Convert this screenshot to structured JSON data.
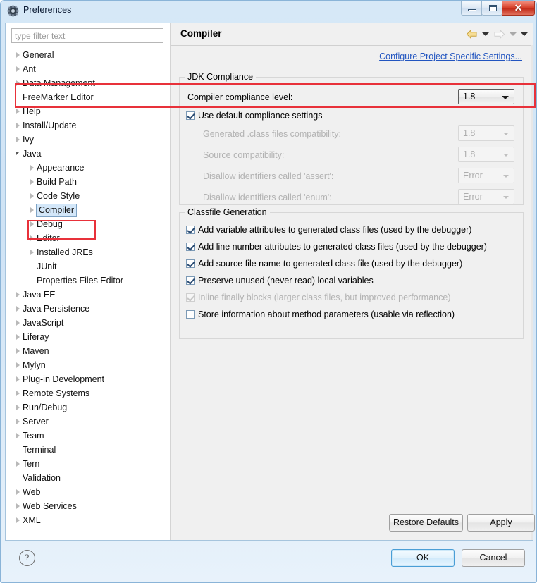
{
  "window": {
    "title": "Preferences",
    "icon": "preferences-gear-icon",
    "controls": {
      "minimize": "minimize-button",
      "maximize": "maximize-button",
      "close_glyph": "✕"
    }
  },
  "sidebar": {
    "filter": {
      "placeholder": "type filter text",
      "value": ""
    },
    "items": [
      {
        "label": "General",
        "indent": 0,
        "twisty": "collapsed",
        "selected": false
      },
      {
        "label": "Ant",
        "indent": 0,
        "twisty": "collapsed",
        "selected": false
      },
      {
        "label": "Data Management",
        "indent": 0,
        "twisty": "collapsed",
        "selected": false
      },
      {
        "label": "FreeMarker Editor",
        "indent": 0,
        "twisty": "none",
        "selected": false
      },
      {
        "label": "Help",
        "indent": 0,
        "twisty": "collapsed",
        "selected": false
      },
      {
        "label": "Install/Update",
        "indent": 0,
        "twisty": "collapsed",
        "selected": false
      },
      {
        "label": "Ivy",
        "indent": 0,
        "twisty": "collapsed",
        "selected": false
      },
      {
        "label": "Java",
        "indent": 0,
        "twisty": "expanded",
        "selected": false
      },
      {
        "label": "Appearance",
        "indent": 1,
        "twisty": "collapsed",
        "selected": false
      },
      {
        "label": "Build Path",
        "indent": 1,
        "twisty": "collapsed",
        "selected": false
      },
      {
        "label": "Code Style",
        "indent": 1,
        "twisty": "collapsed",
        "selected": false
      },
      {
        "label": "Compiler",
        "indent": 1,
        "twisty": "collapsed",
        "selected": true
      },
      {
        "label": "Debug",
        "indent": 1,
        "twisty": "collapsed",
        "selected": false
      },
      {
        "label": "Editor",
        "indent": 1,
        "twisty": "collapsed",
        "selected": false
      },
      {
        "label": "Installed JREs",
        "indent": 1,
        "twisty": "collapsed",
        "selected": false
      },
      {
        "label": "JUnit",
        "indent": 1,
        "twisty": "none",
        "selected": false
      },
      {
        "label": "Properties Files Editor",
        "indent": 1,
        "twisty": "none",
        "selected": false
      },
      {
        "label": "Java EE",
        "indent": 0,
        "twisty": "collapsed",
        "selected": false
      },
      {
        "label": "Java Persistence",
        "indent": 0,
        "twisty": "collapsed",
        "selected": false
      },
      {
        "label": "JavaScript",
        "indent": 0,
        "twisty": "collapsed",
        "selected": false
      },
      {
        "label": "Liferay",
        "indent": 0,
        "twisty": "collapsed",
        "selected": false
      },
      {
        "label": "Maven",
        "indent": 0,
        "twisty": "collapsed",
        "selected": false
      },
      {
        "label": "Mylyn",
        "indent": 0,
        "twisty": "collapsed",
        "selected": false
      },
      {
        "label": "Plug-in Development",
        "indent": 0,
        "twisty": "collapsed",
        "selected": false
      },
      {
        "label": "Remote Systems",
        "indent": 0,
        "twisty": "collapsed",
        "selected": false
      },
      {
        "label": "Run/Debug",
        "indent": 0,
        "twisty": "collapsed",
        "selected": false
      },
      {
        "label": "Server",
        "indent": 0,
        "twisty": "collapsed",
        "selected": false
      },
      {
        "label": "Team",
        "indent": 0,
        "twisty": "collapsed",
        "selected": false
      },
      {
        "label": "Terminal",
        "indent": 0,
        "twisty": "none",
        "selected": false
      },
      {
        "label": "Tern",
        "indent": 0,
        "twisty": "collapsed",
        "selected": false
      },
      {
        "label": "Validation",
        "indent": 0,
        "twisty": "none",
        "selected": false
      },
      {
        "label": "Web",
        "indent": 0,
        "twisty": "collapsed",
        "selected": false
      },
      {
        "label": "Web Services",
        "indent": 0,
        "twisty": "collapsed",
        "selected": false
      },
      {
        "label": "XML",
        "indent": 0,
        "twisty": "collapsed",
        "selected": false
      }
    ]
  },
  "content": {
    "title": "Compiler",
    "nav": {
      "back_icon": "back-arrow-icon",
      "back_menu_icon": "chevron-down-icon",
      "forward_icon": "forward-arrow-icon",
      "forward_menu_icon": "chevron-down-icon",
      "overflow_icon": "chevron-down-icon"
    },
    "configure_link": "Configure Project Specific Settings...",
    "jdk_compliance": {
      "group_title": "JDK Compliance",
      "compliance_level_label": "Compiler compliance level:",
      "compliance_level_value": "1.8",
      "use_default_label": "Use default compliance settings",
      "use_default_checked": true,
      "rows": [
        {
          "label": "Generated .class files compatibility:",
          "value": "1.8",
          "disabled": true
        },
        {
          "label": "Source compatibility:",
          "value": "1.8",
          "disabled": true
        },
        {
          "label": "Disallow identifiers called 'assert':",
          "value": "Error",
          "disabled": true
        },
        {
          "label": "Disallow identifiers called 'enum':",
          "value": "Error",
          "disabled": true
        }
      ]
    },
    "classfile_generation": {
      "group_title": "Classfile Generation",
      "options": [
        {
          "label": "Add variable attributes to generated class files (used by the debugger)",
          "checked": true,
          "disabled": false
        },
        {
          "label": "Add line number attributes to generated class files (used by the debugger)",
          "checked": true,
          "disabled": false
        },
        {
          "label": "Add source file name to generated class file (used by the debugger)",
          "checked": true,
          "disabled": false
        },
        {
          "label": "Preserve unused (never read) local variables",
          "checked": true,
          "disabled": false
        },
        {
          "label": "Inline finally blocks (larger class files, but improved performance)",
          "checked": true,
          "disabled": true
        },
        {
          "label": "Store information about method parameters (usable via reflection)",
          "checked": false,
          "disabled": false
        }
      ]
    },
    "buttons": {
      "restore_defaults": "Restore Defaults",
      "apply": "Apply"
    }
  },
  "footer": {
    "help_icon": "help-question-icon",
    "help_glyph": "?",
    "ok": "OK",
    "cancel": "Cancel"
  },
  "colors": {
    "annotation_red": "#e8313a",
    "link_blue": "#2255c0",
    "selection_blue": "#d3e7f9",
    "titlebar_blue": "#cfe3f5",
    "close_red": "#c22a18"
  }
}
